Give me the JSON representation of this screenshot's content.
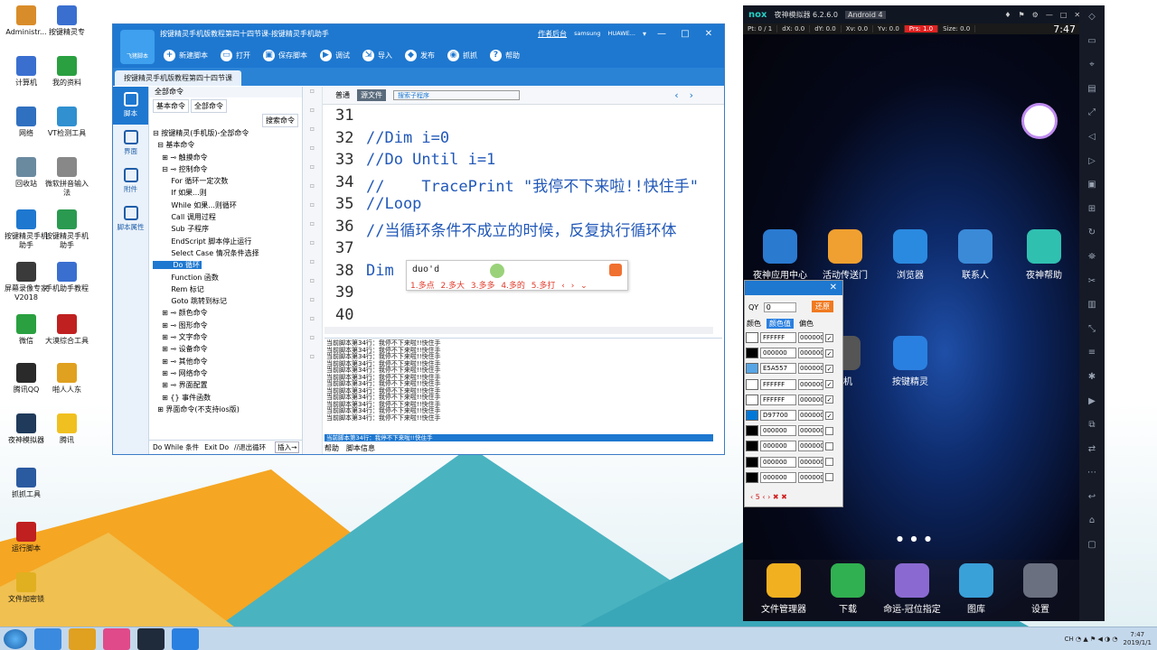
{
  "desktop": {
    "icons": [
      {
        "label": "Administr...",
        "color": "#d98c2a"
      },
      {
        "label": "按键精灵专",
        "color": "#3a6fd0"
      },
      {
        "label": "计算机",
        "color": "#3a6fd0"
      },
      {
        "label": "我的资料",
        "color": "#2aa040"
      },
      {
        "label": "网络",
        "color": "#3070c0"
      },
      {
        "label": "VT检测工具",
        "color": "#3090d0"
      },
      {
        "label": "回收站",
        "color": "#6a8aa0"
      },
      {
        "label": "微软拼音输入法",
        "color": "#888888"
      },
      {
        "label": "按键精灵手机助手",
        "color": "#1e78d0"
      },
      {
        "label": "按键精灵手机助手",
        "color": "#2a9a50"
      },
      {
        "label": "屏幕录像专家 V2018",
        "color": "#3a3a3a"
      },
      {
        "label": "手机助手教程",
        "color": "#3a6fd0"
      },
      {
        "label": "微信",
        "color": "#2aa040"
      },
      {
        "label": "大漠综合工具",
        "color": "#c02020"
      },
      {
        "label": "腾讯QQ",
        "color": "#2a2a2a"
      },
      {
        "label": "啪人人东",
        "color": "#e0a020"
      },
      {
        "label": "夜神模拟器",
        "color": "#1f3a5a"
      },
      {
        "label": "腾讯",
        "color": "#f0c020"
      },
      {
        "label": "抓抓工具",
        "color": "#2a5aa0"
      },
      {
        "label": "运行脚本",
        "color": "#c02020"
      },
      {
        "label": "文件加密锁",
        "color": "#e0b020"
      }
    ]
  },
  "editor": {
    "window_title": "按键精灵手机版教程第四十四节课-按键精灵手机助手",
    "logo_label": "飞猪脚本",
    "title_links": [
      "作者后台",
      "samsung",
      "HUAWE...",
      "▾"
    ],
    "window_controls": [
      "—",
      "□",
      "✕"
    ],
    "toolbar": [
      {
        "icon": "+",
        "label": "新建脚本"
      },
      {
        "icon": "▭",
        "label": "打开"
      },
      {
        "icon": "▣",
        "label": "保存脚本"
      },
      {
        "icon": "▶",
        "label": "调试"
      },
      {
        "icon": "⇲",
        "label": "导入"
      },
      {
        "icon": "◆",
        "label": "发布"
      },
      {
        "icon": "◉",
        "label": "抓抓"
      },
      {
        "icon": "?",
        "label": "帮助"
      }
    ],
    "doc_tab": "按键精灵手机版教程第四十四节课",
    "rail": [
      "脚本",
      "界面",
      "附件",
      "脚本属性"
    ],
    "cmd_header": "全部命令",
    "cmd_tabs": [
      "基本命令",
      "全部命令"
    ],
    "search_label": "搜索命令",
    "tree": [
      "⊟ 按键精灵(手机版)-全部命令",
      "  ⊟ 基本命令",
      "    ⊞ ⊸ 触摸命令",
      "    ⊟ ⊸ 控制命令",
      "        For 循环一定次数",
      "        If 如果...则",
      "        While 如果...则循环",
      "        Call 调用过程",
      "        Sub 子程序",
      "        EndScript 脚本停止运行",
      "        Select Case 情况条件选择",
      "        Do 循环",
      "        Function 函数",
      "        Rem 标记",
      "        Goto 跳转到标记",
      "    ⊞ ⊸ 颜色命令",
      "    ⊞ ⊸ 图形命令",
      "    ⊞ ⊸ 文字命令",
      "    ⊞ ⊸ 设备命令",
      "    ⊞ ⊸ 其他命令",
      "    ⊞ ⊸ 网络命令",
      "    ⊞ ⊸ 界面配置",
      "    ⊞ {} 事件函数",
      "  ⊞ 界面命令(不支持ios版)"
    ],
    "selected_tree_index": 11,
    "cmd_footer": [
      "Do While 条件",
      "Exit Do",
      "//退出循环",
      "插入→"
    ],
    "editor_tabs": {
      "normal": "普通",
      "source": "源文件",
      "sub": "搜索子程序"
    },
    "lines": [
      {
        "n": "31",
        "t": ""
      },
      {
        "n": "32",
        "t": "//Dim i=0"
      },
      {
        "n": "33",
        "t": "//Do Until i=1"
      },
      {
        "n": "34",
        "t": "//    TracePrint \"我停不下来啦!!快住手\""
      },
      {
        "n": "35",
        "t": "//Loop"
      },
      {
        "n": "36",
        "t": "//当循环条件不成立的时候，反复执行循环体"
      },
      {
        "n": "37",
        "t": ""
      },
      {
        "n": "38",
        "t": "Dim |"
      },
      {
        "n": "39",
        "t": ""
      },
      {
        "n": "40",
        "t": ""
      }
    ],
    "ime": {
      "pinyin": "duo'd",
      "candidates": "1.多点 2.多大 3.多多 4.多的 5.多打 ‹ › ⌄"
    },
    "output_line": "当前脚本第34行：我停不下来啦!!快住手",
    "output_repeat": 12,
    "status": "当前脚本第34行：我停不下来啦!!快住手",
    "out_tabs": [
      "帮助",
      "脚本信息"
    ]
  },
  "emulator": {
    "brand": "nox",
    "title": "夜神模拟器 6.2.6.0",
    "android": "Android 4",
    "controls": [
      "♦",
      "⚑",
      "⚙",
      "—",
      "□",
      "✕",
      "«"
    ],
    "status": [
      "Pt: 0 / 1",
      "dX: 0.0",
      "dY: 0.0",
      "Xv: 0.0",
      "Yv: 0.0",
      "Prs: 1.0",
      "Size: 0.0"
    ],
    "clock": "7:47",
    "apps": [
      {
        "label": "夜神应用中心",
        "color": "#2a7ad0"
      },
      {
        "label": "活动传送门",
        "color": "#f0a030"
      },
      {
        "label": "浏览器",
        "color": "#2a8ae0"
      },
      {
        "label": "联系人",
        "color": "#3a8ad8"
      },
      {
        "label": "夜神帮助",
        "color": "#30c0b0"
      },
      {
        "label": "相机",
        "color": "#555555"
      },
      {
        "label": "按键精灵",
        "color": "#2a80e0"
      }
    ],
    "dock": [
      {
        "label": "文件管理器",
        "color": "#f0b020"
      },
      {
        "label": "下载",
        "color": "#30b050"
      },
      {
        "label": "命运-冠位指定",
        "color": "#8a6ad0"
      },
      {
        "label": "图库",
        "color": "#3aa0d8"
      },
      {
        "label": "设置",
        "color": "#6a7080"
      }
    ],
    "side_tools": [
      "◇",
      "▭",
      "⌖",
      "▤",
      "⤢",
      "◁",
      "▷",
      "▣",
      "⊞",
      "↻",
      "⛯",
      "✂",
      "▥",
      "⤡",
      "≡",
      "✱",
      "▶",
      "⧉",
      "⇄",
      "⋯"
    ],
    "nav": [
      "↩",
      "⌂",
      "▢"
    ]
  },
  "picker": {
    "qy_label": "QY",
    "qy_value": "0",
    "restore": "还原",
    "col_a": "颜色",
    "col_b": "颜色值",
    "col_c": "偏色",
    "rows": [
      {
        "swatch": "#FFFFFF",
        "hex": "FFFFFF",
        "off": "000000",
        "checked": true
      },
      {
        "swatch": "#000000",
        "hex": "000000",
        "off": "000000",
        "checked": true
      },
      {
        "swatch": "#57A5E5",
        "hex": "E5A557",
        "off": "000000",
        "checked": true
      },
      {
        "swatch": "#FFFFFF",
        "hex": "FFFFFF",
        "off": "000000",
        "checked": true
      },
      {
        "swatch": "#FFFFFF",
        "hex": "FFFFFF",
        "off": "000000",
        "checked": true
      },
      {
        "swatch": "#0077D9",
        "hex": "D97700",
        "off": "000000",
        "checked": true
      },
      {
        "swatch": "#000000",
        "hex": "000000",
        "off": "000000",
        "checked": false
      },
      {
        "swatch": "#000000",
        "hex": "000000",
        "off": "000000",
        "checked": false
      },
      {
        "swatch": "#000000",
        "hex": "000000",
        "off": "000000",
        "checked": false
      },
      {
        "swatch": "#000000",
        "hex": "000000",
        "off": "000000",
        "checked": false
      }
    ],
    "footer": "‹  5  ‹  ›  ✖  ✖"
  },
  "taskbar": {
    "apps": [
      {
        "name": "baidu-netdisk",
        "color": "#3a8ae0"
      },
      {
        "name": "pen-tool",
        "color": "#e0a020"
      },
      {
        "name": "color-wheel",
        "color": "#e04a8a"
      },
      {
        "name": "nox",
        "color": "#1f2a3a"
      },
      {
        "name": "anjian",
        "color": "#2a80e0"
      }
    ],
    "tray": "CH ◔ ▲ ⚑ ◀ ◑ ◔",
    "time": "7:47",
    "date": "2019/1/1"
  }
}
